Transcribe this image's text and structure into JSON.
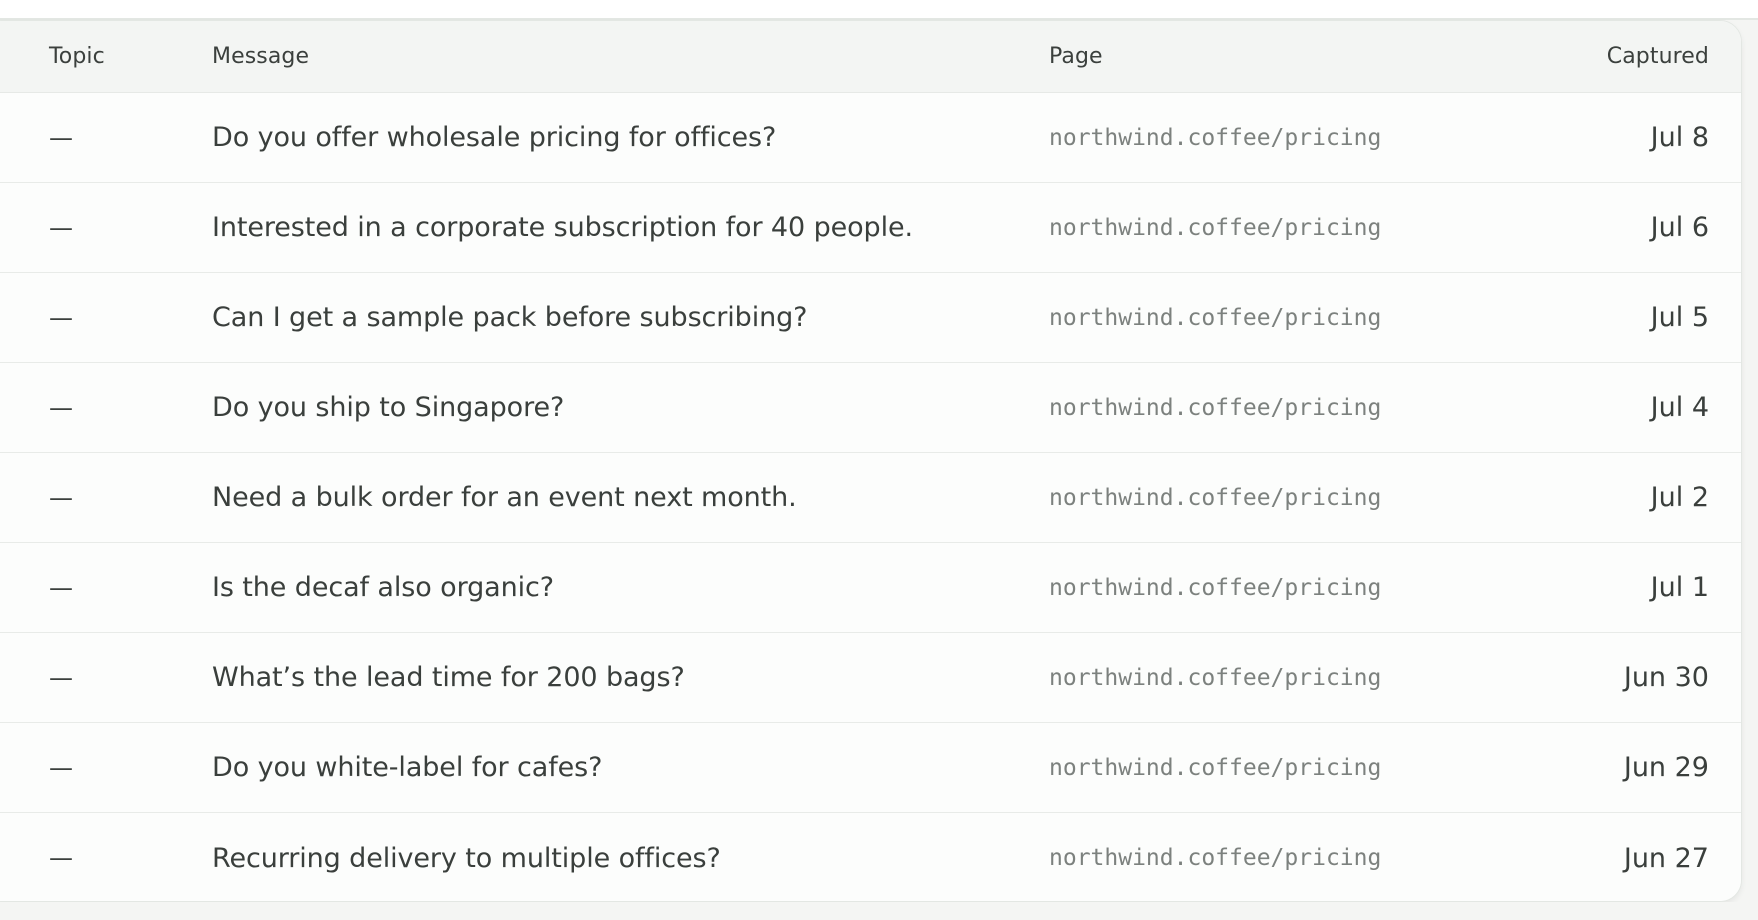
{
  "table": {
    "headers": {
      "topic": "Topic",
      "message": "Message",
      "page": "Page",
      "captured": "Captured"
    },
    "rows": [
      {
        "topic": "—",
        "message": "Do you offer wholesale pricing for offices?",
        "page": "northwind.coffee/pricing",
        "captured": "Jul 8"
      },
      {
        "topic": "—",
        "message": "Interested in a corporate subscription for 40 people.",
        "page": "northwind.coffee/pricing",
        "captured": "Jul 6"
      },
      {
        "topic": "—",
        "message": "Can I get a sample pack before subscribing?",
        "page": "northwind.coffee/pricing",
        "captured": "Jul 5"
      },
      {
        "topic": "—",
        "message": "Do you ship to Singapore?",
        "page": "northwind.coffee/pricing",
        "captured": "Jul 4"
      },
      {
        "topic": "—",
        "message": "Need a bulk order for an event next month.",
        "page": "northwind.coffee/pricing",
        "captured": "Jul 2"
      },
      {
        "topic": "—",
        "message": "Is the decaf also organic?",
        "page": "northwind.coffee/pricing",
        "captured": "Jul 1"
      },
      {
        "topic": "—",
        "message": "What’s the lead time for 200 bags?",
        "page": "northwind.coffee/pricing",
        "captured": "Jun 30"
      },
      {
        "topic": "—",
        "message": "Do you white-label for cafes?",
        "page": "northwind.coffee/pricing",
        "captured": "Jun 29"
      },
      {
        "topic": "—",
        "message": "Recurring delivery to multiple offices?",
        "page": "northwind.coffee/pricing",
        "captured": "Jun 27"
      }
    ]
  },
  "colors": {
    "header_bg": "#f3f5f3",
    "row_bg": "#fcfdfc",
    "divider": "#e8ebe8",
    "text": "#3a3f3c",
    "muted": "#7c817e"
  }
}
